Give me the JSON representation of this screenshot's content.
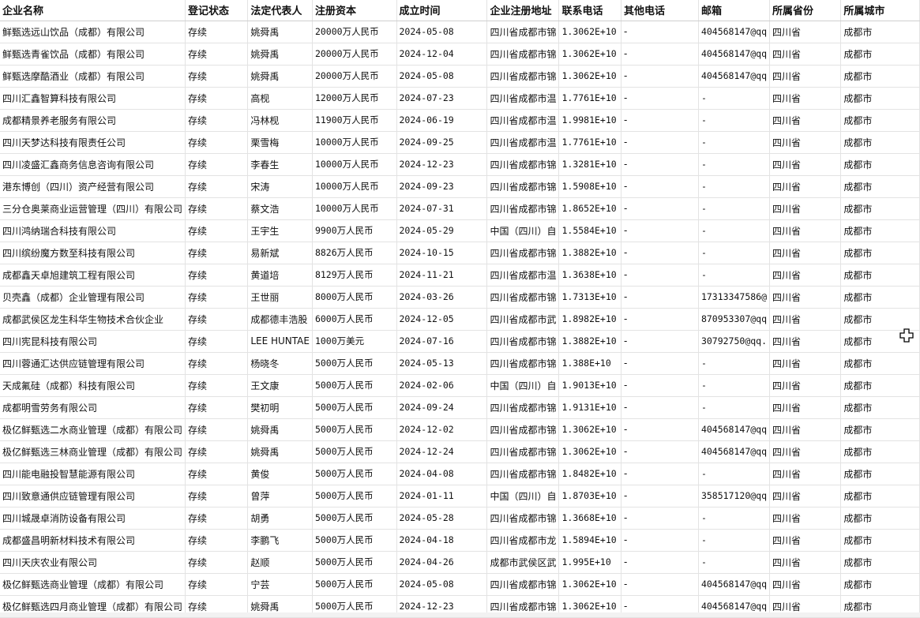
{
  "columns": [
    "企业名称",
    "登记状态",
    "法定代表人",
    "注册资本",
    "成立时间",
    "企业注册地址",
    "联系电话",
    "其他电话",
    "邮箱",
    "所属省份",
    "所属城市"
  ],
  "rows": [
    [
      "鲜甄选远山饮品（成都）有限公司",
      "存续",
      "姚舜禹",
      "20000万人民币",
      "2024-05-08",
      "四川省成都市锦",
      "1.3062E+10",
      "-",
      "404568147@qq",
      "四川省",
      "成都市"
    ],
    [
      "鲜甄选青雀饮品（成都）有限公司",
      "存续",
      "姚舜禹",
      "20000万人民币",
      "2024-12-04",
      "四川省成都市锦",
      "1.3062E+10",
      "-",
      "404568147@qq",
      "四川省",
      "成都市"
    ],
    [
      "鲜甄选摩酷酒业（成都）有限公司",
      "存续",
      "姚舜禹",
      "20000万人民币",
      "2024-05-08",
      "四川省成都市锦",
      "1.3062E+10",
      "-",
      "404568147@qq",
      "四川省",
      "成都市"
    ],
    [
      "四川汇鑫智算科技有限公司",
      "存续",
      "高枧",
      "12000万人民币",
      "2024-07-23",
      "四川省成都市温",
      "1.7761E+10",
      "-",
      "-",
      "四川省",
      "成都市"
    ],
    [
      "成都精景养老服务有限公司",
      "存续",
      "冯林枧",
      "11900万人民币",
      "2024-06-19",
      "四川省成都市温",
      "1.9981E+10",
      "-",
      "-",
      "四川省",
      "成都市"
    ],
    [
      "四川天梦达科技有限责任公司",
      "存续",
      "栗雪梅",
      "10000万人民币",
      "2024-09-25",
      "四川省成都市温",
      "1.7761E+10",
      "-",
      "-",
      "四川省",
      "成都市"
    ],
    [
      "四川凌盛汇鑫商务信息咨询有限公司",
      "存续",
      "李春生",
      "10000万人民币",
      "2024-12-23",
      "四川省成都市锦",
      "1.3281E+10",
      "-",
      "-",
      "四川省",
      "成都市"
    ],
    [
      "港东博创（四川）资产经营有限公司",
      "存续",
      "宋涛",
      "10000万人民币",
      "2024-09-23",
      "四川省成都市锦",
      "1.5908E+10",
      "-",
      "-",
      "四川省",
      "成都市"
    ],
    [
      "三分仓奥莱商业运营管理（四川）有限公司",
      "存续",
      "蔡文浩",
      "10000万人民币",
      "2024-07-31",
      "四川省成都市锦",
      "1.8652E+10",
      "-",
      "-",
      "四川省",
      "成都市"
    ],
    [
      "四川鸿纳瑞合科技有限公司",
      "存续",
      "王宇生",
      "9900万人民币",
      "2024-05-29",
      "中国（四川）自",
      "1.5584E+10",
      "-",
      "-",
      "四川省",
      "成都市"
    ],
    [
      "四川缤纷魔方数至科技有限公司",
      "存续",
      "易新斌",
      "8826万人民币",
      "2024-10-15",
      "四川省成都市锦",
      "1.3882E+10",
      "-",
      "-",
      "四川省",
      "成都市"
    ],
    [
      "成都鑫天卓旭建筑工程有限公司",
      "存续",
      "黄道培",
      "8129万人民币",
      "2024-11-21",
      "四川省成都市温",
      "1.3638E+10",
      "-",
      "-",
      "四川省",
      "成都市"
    ],
    [
      "贝壳鑫（成都）企业管理有限公司",
      "存续",
      "王世丽",
      "8000万人民币",
      "2024-03-26",
      "四川省成都市锦",
      "1.7313E+10",
      "-",
      "17313347586@",
      "四川省",
      "成都市"
    ],
    [
      "成都武侯区龙生科华生物技术合伙企业",
      "存续",
      "成都德丰浩股",
      "6000万人民币",
      "2024-12-05",
      "四川省成都市武",
      "1.8982E+10",
      "-",
      "870953307@qq",
      "四川省",
      "成都市"
    ],
    [
      "四川宪昆科技有限公司",
      "存续",
      "LEE HUNTAE",
      "1000万美元",
      "2024-07-16",
      "四川省成都市锦",
      "1.3882E+10",
      "-",
      "30792750@qq.",
      "四川省",
      "成都市"
    ],
    [
      "四川蓉通汇达供应链管理有限公司",
      "存续",
      "杨晓冬",
      "5000万人民币",
      "2024-05-13",
      "四川省成都市锦",
      "1.388E+10",
      "-",
      "-",
      "四川省",
      "成都市"
    ],
    [
      "天成氟硅（成都）科技有限公司",
      "存续",
      "王文康",
      "5000万人民币",
      "2024-02-06",
      "中国（四川）自",
      "1.9013E+10",
      "-",
      "-",
      "四川省",
      "成都市"
    ],
    [
      "成都明雪劳务有限公司",
      "存续",
      "樊初明",
      "5000万人民币",
      "2024-09-24",
      "四川省成都市锦",
      "1.9131E+10",
      "-",
      "-",
      "四川省",
      "成都市"
    ],
    [
      "极亿鲜甄选二水商业管理（成都）有限公司",
      "存续",
      "姚舜禹",
      "5000万人民币",
      "2024-12-02",
      "四川省成都市锦",
      "1.3062E+10",
      "-",
      "404568147@qq",
      "四川省",
      "成都市"
    ],
    [
      "极亿鲜甄选三林商业管理（成都）有限公司",
      "存续",
      "姚舜禹",
      "5000万人民币",
      "2024-12-24",
      "四川省成都市锦",
      "1.3062E+10",
      "-",
      "404568147@qq",
      "四川省",
      "成都市"
    ],
    [
      "四川能电融投智慧能源有限公司",
      "存续",
      "黄俊",
      "5000万人民币",
      "2024-04-08",
      "四川省成都市锦",
      "1.8482E+10",
      "-",
      "-",
      "四川省",
      "成都市"
    ],
    [
      "四川致意通供应链管理有限公司",
      "存续",
      "曾萍",
      "5000万人民币",
      "2024-01-11",
      "中国（四川）自",
      "1.8703E+10",
      "-",
      "358517120@qq",
      "四川省",
      "成都市"
    ],
    [
      "四川城晟卓消防设备有限公司",
      "存续",
      "胡勇",
      "5000万人民币",
      "2024-05-28",
      "四川省成都市锦",
      "1.3668E+10",
      "-",
      "-",
      "四川省",
      "成都市"
    ],
    [
      "成都盛昌明新材料技术有限公司",
      "存续",
      "李鹏飞",
      "5000万人民币",
      "2024-04-18",
      "四川省成都市龙",
      "1.5894E+10",
      "-",
      "-",
      "四川省",
      "成都市"
    ],
    [
      "四川天庆农业有限公司",
      "存续",
      "赵顺",
      "5000万人民币",
      "2024-04-26",
      "成都市武侯区武",
      "1.995E+10",
      "-",
      "-",
      "四川省",
      "成都市"
    ],
    [
      "极亿鲜甄选商业管理（成都）有限公司",
      "存续",
      "宁芸",
      "5000万人民币",
      "2024-05-08",
      "四川省成都市锦",
      "1.3062E+10",
      "-",
      "404568147@qq",
      "四川省",
      "成都市"
    ],
    [
      "极亿鲜甄选四月商业管理（成都）有限公司",
      "存续",
      "姚舜禹",
      "5000万人民币",
      "2024-12-23",
      "四川省成都市锦",
      "1.3062E+10",
      "-",
      "404568147@qq",
      "四川省",
      "成都市"
    ]
  ]
}
